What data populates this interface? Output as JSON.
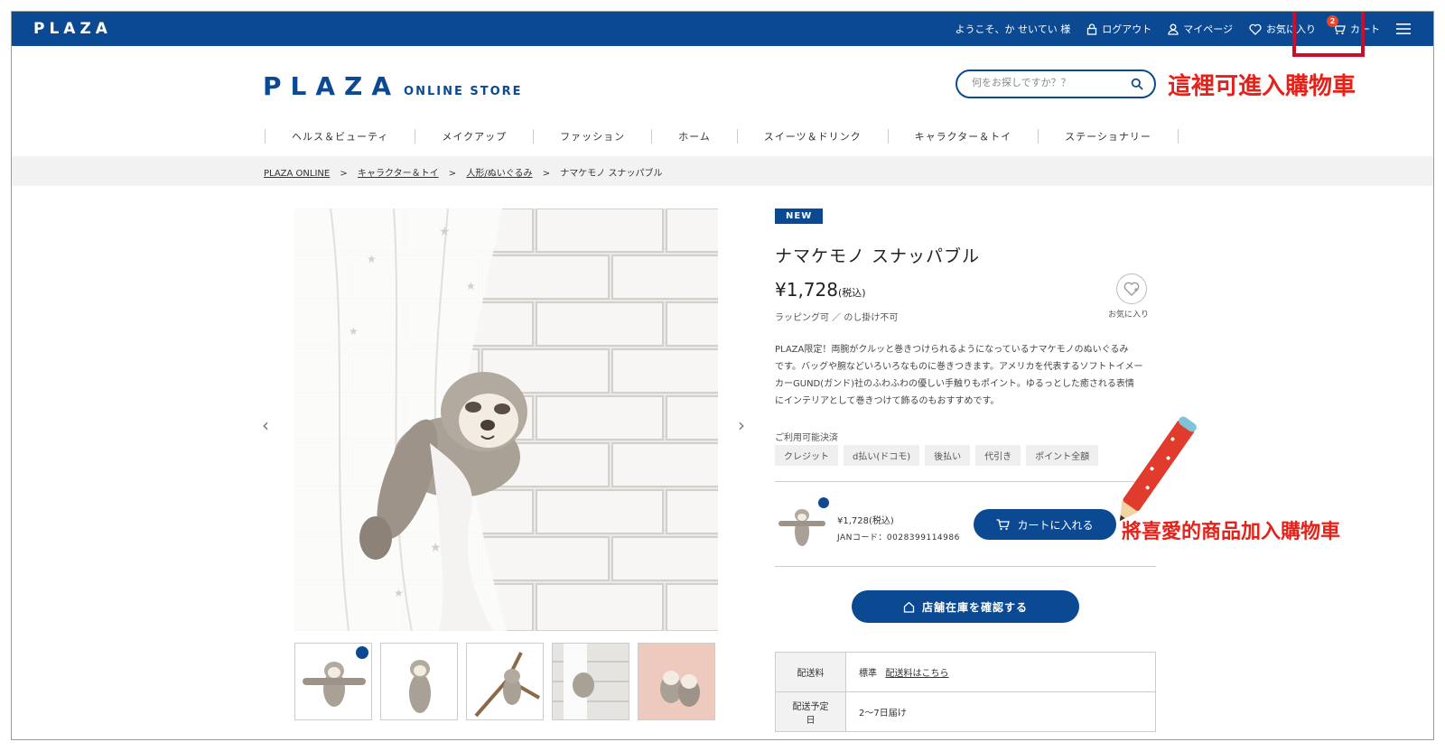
{
  "topbar": {
    "logo": "PLAZA",
    "greeting": "ようこそ、か せいてい 様",
    "logout": "ログアウト",
    "mypage": "マイページ",
    "favorites": "お気に入り",
    "cart": "カート",
    "cart_count": "2"
  },
  "header": {
    "brand": "PLAZA",
    "brand_sub": "ONLINE STORE",
    "search_placeholder": "何をお探しですか？？"
  },
  "annotations": {
    "cart_note": "這裡可進入購物車",
    "add_note": "將喜愛的商品加入購物車"
  },
  "categories": [
    "ヘルス＆ビューティ",
    "メイクアップ",
    "ファッション",
    "ホーム",
    "スイーツ＆ドリンク",
    "キャラクター＆トイ",
    "ステーショナリー"
  ],
  "breadcrumb": {
    "home": "PLAZA ONLINE",
    "cat": "キャラクター＆トイ",
    "sub": "人形/ぬいぐるみ",
    "current": "ナマケモノ スナッパブル",
    "sep": ">"
  },
  "product": {
    "badge": "NEW",
    "title": "ナマケモノ スナッパブル",
    "price": "¥1,728",
    "tax": "(税込)",
    "wrap_note": "ラッピング可 ／ のし掛け不可",
    "fav_label": "お気に入り",
    "desc": [
      "PLAZA限定！両腕がクルッと巻きつけられるようになっているナマケモノのぬいぐるみ",
      "です。バッグや腕などいろいろなものに巻きつきます。アメリカを代表するソフトトイメー",
      "カーGUND(ガンド)社のふわふわの優しい手触りもポイント。ゆるっとした癒される表情",
      "にインテリアとして巻きつけて飾るのもおすすめです。"
    ],
    "payment_label": "ご利用可能決済",
    "payments": [
      "クレジット",
      "d払い(ドコモ)",
      "後払い",
      "代引き",
      "ポイント全額"
    ],
    "sku_price": "¥1,728(税込)",
    "sku_jan": "JANコード：0028399114986",
    "add_to_cart": "カートに入れる",
    "stock_check": "店舗在庫を確認する"
  },
  "shipping": {
    "fee_label": "配送料",
    "fee_value": "標準",
    "fee_link": "配送料はこちら",
    "eta_label": "配送予定日",
    "eta_value": "2～7日届け"
  },
  "colors": {
    "brand_blue": "#0b4a93",
    "annotation_red": "#e5221a"
  }
}
